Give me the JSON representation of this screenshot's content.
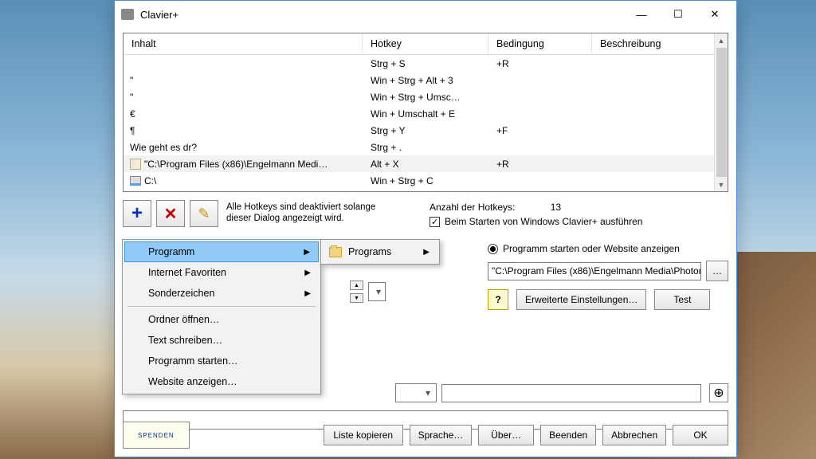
{
  "window": {
    "title": "Clavier+"
  },
  "columns": {
    "inhalt": "Inhalt",
    "hotkey": "Hotkey",
    "bedingung": "Bedingung",
    "beschreibung": "Beschreibung"
  },
  "rows": [
    {
      "inhalt": "",
      "hotkey": "Strg + S",
      "bedingung": "+R",
      "desc": "",
      "icon": null
    },
    {
      "inhalt": "\"",
      "hotkey": "Win + Strg + Alt + 3",
      "bedingung": "",
      "desc": "",
      "icon": null
    },
    {
      "inhalt": "\"",
      "hotkey": "Win + Strg + Umsc…",
      "bedingung": "",
      "desc": "",
      "icon": null
    },
    {
      "inhalt": "€",
      "hotkey": "Win + Umschalt + E",
      "bedingung": "",
      "desc": "",
      "icon": null
    },
    {
      "inhalt": "¶",
      "hotkey": "Strg + Y",
      "bedingung": "+F",
      "desc": "",
      "icon": null
    },
    {
      "inhalt": "Wie geht es dr?",
      "hotkey": "Strg + .",
      "bedingung": "",
      "desc": "",
      "icon": null
    },
    {
      "inhalt": "\"C:\\Program Files (x86)\\Engelmann Medi…",
      "hotkey": "Alt + X",
      "bedingung": "+R",
      "desc": "",
      "icon": "note",
      "selected": true
    },
    {
      "inhalt": "C:\\",
      "hotkey": "Win + Strg + C",
      "bedingung": "",
      "desc": "",
      "icon": "drive"
    }
  ],
  "toolbar": {
    "hint_line1": "Alle Hotkeys sind deaktiviert solange",
    "hint_line2": "dieser Dialog angezeigt wird.",
    "count_label": "Anzahl der Hotkeys:",
    "count_value": "13",
    "autostart_label": "Beim Starten von Windows Clavier+ ausführen"
  },
  "option": {
    "radio_label": "Programm starten oder Website anzeigen",
    "path_value": "\"C:\\Program Files (x86)\\Engelmann Media\\Photom",
    "advanced_label": "Erweiterte Einstellungen…",
    "test_label": "Test"
  },
  "menu": {
    "items": [
      {
        "label": "Programm",
        "sub": true
      },
      {
        "label": "Internet Favoriten",
        "sub": true
      },
      {
        "label": "Sonderzeichen",
        "sub": true
      }
    ],
    "sep_items": [
      {
        "label": "Ordner öffnen…"
      },
      {
        "label": "Text schreiben…"
      },
      {
        "label": "Programm starten…"
      },
      {
        "label": "Website anzeigen…"
      }
    ],
    "sub_label": "Programs"
  },
  "bottom": {
    "donate": "SPENDEN",
    "liste_kopieren": "Liste kopieren",
    "sprache": "Sprache…",
    "ueber": "Über…",
    "beenden": "Beenden",
    "abbrechen": "Abbrechen",
    "ok": "OK"
  }
}
